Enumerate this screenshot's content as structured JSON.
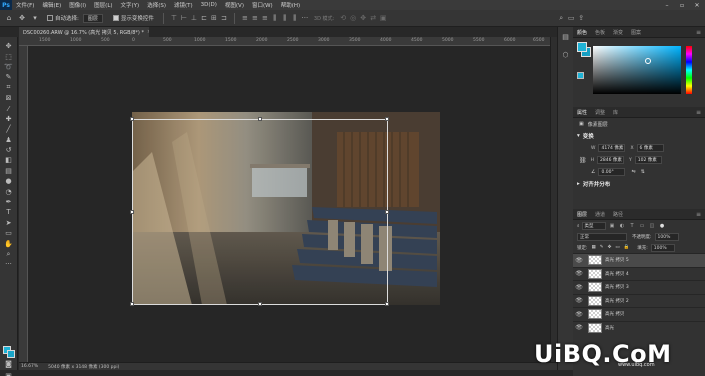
{
  "app": {
    "logo": "Ps"
  },
  "menu": [
    "文件(F)",
    "编辑(E)",
    "图像(I)",
    "图层(L)",
    "文字(Y)",
    "选择(S)",
    "滤镜(T)",
    "3D(D)",
    "视图(V)",
    "窗口(W)",
    "帮助(H)"
  ],
  "options": {
    "auto_select_label": "自动选择:",
    "auto_select_value": "图层",
    "show_transform_label": "显示变换控件",
    "mode_3d": "3D 模式:"
  },
  "document": {
    "tab_title": "DSC00260.ARW @ 16.7% (高光 拷贝 5, RGB/8*) *",
    "tab_close": "×"
  },
  "ruler": {
    "ticks": [
      "1500",
      "1000",
      "500",
      "0",
      "500",
      "1000",
      "1500",
      "2000",
      "2500",
      "3000",
      "3500",
      "4000",
      "4500",
      "5000",
      "5500",
      "6000",
      "6500"
    ]
  },
  "status": {
    "zoom": "16.67%",
    "info": "5040 像素 x 3148 像素 (300 ppi)"
  },
  "colors": {
    "foreground": "#1fb3d6",
    "background": "#16a0c4"
  },
  "color_panel": {
    "tabs": [
      "颜色",
      "色板",
      "渐变",
      "图案"
    ]
  },
  "properties": {
    "tabs": [
      "属性",
      "调整",
      "库"
    ],
    "type_label": "像素图层",
    "transform_header": "变换",
    "w_label": "W",
    "w_value": "4174 像素",
    "x_label": "X",
    "x_value": "6 像素",
    "h_label": "H",
    "h_value": "2846 像素",
    "y_label": "Y",
    "y_value": "102 像素",
    "angle_value": "0.00°",
    "align_header": "对齐并分布"
  },
  "layers_panel": {
    "tabs": [
      "图层",
      "通道",
      "路径"
    ],
    "filter_kind": "类型",
    "blend_mode": "正常",
    "opacity_label": "不透明度:",
    "opacity_value": "100%",
    "lock_label": "锁定:",
    "fill_label": "填充:",
    "fill_value": "100%",
    "layers": [
      {
        "name": "高光 拷贝 5",
        "selected": true
      },
      {
        "name": "高光 拷贝 4",
        "selected": false
      },
      {
        "name": "高光 拷贝 3",
        "selected": false
      },
      {
        "name": "高光 拷贝 2",
        "selected": false
      },
      {
        "name": "高光 拷贝",
        "selected": false
      },
      {
        "name": "高光",
        "selected": false
      }
    ]
  },
  "watermark": {
    "text": "UiBQ.CoM",
    "sub": "www.uibq.com"
  }
}
